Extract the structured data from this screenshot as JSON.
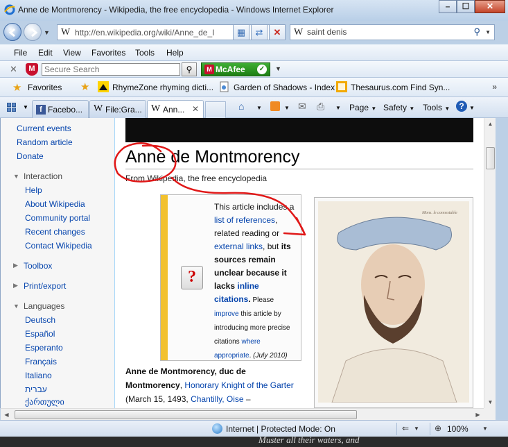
{
  "window": {
    "title": "Anne de Montmorency - Wikipedia, the free encyclopedia - Windows Internet Explorer"
  },
  "address": {
    "url": "http://en.wikipedia.org/wiki/Anne_de_I",
    "search_value": "saint denis"
  },
  "menu": [
    "File",
    "Edit",
    "View",
    "Favorites",
    "Tools",
    "Help"
  ],
  "mcafee": {
    "search_placeholder": "Secure Search",
    "brand": "McAfee"
  },
  "favorites": {
    "label": "Favorites",
    "links": [
      "RhymeZone rhyming dicti...",
      "Garden of Shadows - Index",
      "Thesaurus.com  Find Syn..."
    ]
  },
  "tabs": [
    "Facebo...",
    "File:Gra...",
    "Ann..."
  ],
  "commands": {
    "page": "Page",
    "safety": "Safety",
    "tools": "Tools"
  },
  "sidebar": {
    "nav": [
      "Current events",
      "Random article",
      "Donate"
    ],
    "interaction_heading": "Interaction",
    "interaction": [
      "Help",
      "About Wikipedia",
      "Community portal",
      "Recent changes",
      "Contact Wikipedia"
    ],
    "toolbox": "Toolbox",
    "print": "Print/export",
    "languages_heading": "Languages",
    "languages": [
      "Deutsch",
      "Español",
      "Esperanto",
      "Français",
      "Italiano",
      "עברית",
      "ქართული"
    ]
  },
  "article": {
    "title": "Anne de Montmorency",
    "from": "From Wikipedia, the free encyclopedia",
    "ambox": {
      "t1": "This article includes a ",
      "l1": "list of references",
      "t2": ", related reading or ",
      "l2": "external links",
      "t3": ", but ",
      "b1": "its sources remain unclear because it lacks ",
      "l3": "inline citations",
      "b2": ".",
      "t4": " Please ",
      "l4": "improve",
      "t5": " this article by introducing more precise citations ",
      "l5": "where appropriate",
      "t6": ". ",
      "date": "(July 2010)"
    },
    "lead": {
      "bold": "Anne de Montmorency, duc de Montmorency",
      "t1": ", ",
      "l1": "Honorary Knight of the Garter",
      "t2": " (March 15, 1493, ",
      "l2": "Chantilly, Oise",
      "t3": " –"
    }
  },
  "status": {
    "zone": "Internet | Protected Mode: On",
    "zoom": "100%"
  },
  "below_window_text": "Muster all their waters, and"
}
